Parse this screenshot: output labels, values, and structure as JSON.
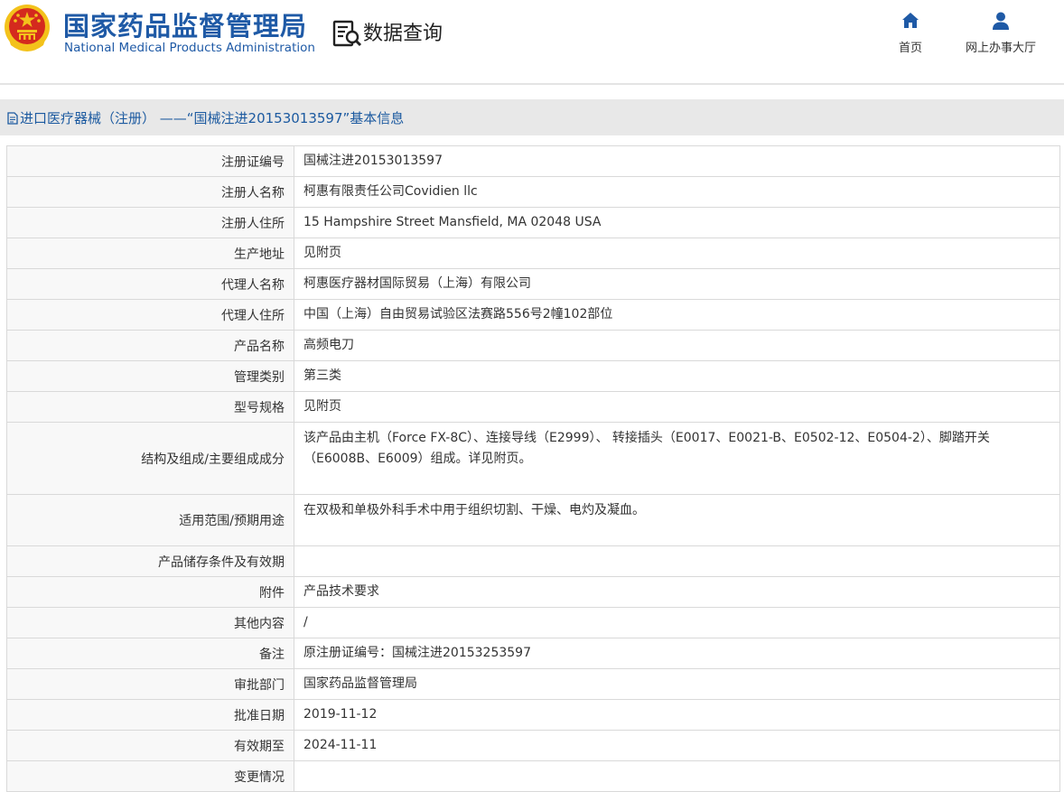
{
  "header": {
    "org_name_cn": "国家药品监督管理局",
    "org_name_en": "National Medical Products Administration",
    "query_title": "数据查询",
    "nav": [
      {
        "label": "首页",
        "icon": "home-icon"
      },
      {
        "label": "网上办事大厅",
        "icon": "user-icon"
      }
    ]
  },
  "title_bar": {
    "text": "进口医疗器械（注册） ——“国械注进20153013597”基本信息"
  },
  "rows": [
    {
      "label": "注册证编号",
      "value": "国械注进20153013597"
    },
    {
      "label": "注册人名称",
      "value": "柯惠有限责任公司Covidien llc"
    },
    {
      "label": "注册人住所",
      "value": "15 Hampshire Street Mansfield, MA 02048 USA"
    },
    {
      "label": "生产地址",
      "value": "见附页"
    },
    {
      "label": "代理人名称",
      "value": "柯惠医疗器材国际贸易（上海）有限公司"
    },
    {
      "label": "代理人住所",
      "value": "中国（上海）自由贸易试验区法赛路556号2幢102部位"
    },
    {
      "label": "产品名称",
      "value": "高频电刀"
    },
    {
      "label": "管理类别",
      "value": "第三类"
    },
    {
      "label": "型号规格",
      "value": "见附页"
    },
    {
      "label": "结构及组成/主要组成成分",
      "value": "该产品由主机（Force FX-8C）、连接导线（E2999）、 转接插头（E0017、E0021-B、E0502-12、E0504-2）、脚踏开关（E6008B、E6009）组成。详见附页。"
    },
    {
      "label": "适用范围/预期用途",
      "value": "在双极和单极外科手术中用于组织切割、干燥、电灼及凝血。"
    },
    {
      "label": "产品储存条件及有效期",
      "value": ""
    },
    {
      "label": "附件",
      "value": "产品技术要求"
    },
    {
      "label": "其他内容",
      "value": "/"
    },
    {
      "label": "备注",
      "value": "原注册证编号：国械注进20153253597"
    },
    {
      "label": "审批部门",
      "value": "国家药品监督管理局"
    },
    {
      "label": "批准日期",
      "value": "2019-11-12"
    },
    {
      "label": "有效期至",
      "value": "2024-11-11"
    },
    {
      "label": "变更情况",
      "value": ""
    }
  ],
  "colors": {
    "brand_blue": "#1f5aa6",
    "emblem_red": "#d42a1e",
    "emblem_gold": "#f3c21b"
  }
}
